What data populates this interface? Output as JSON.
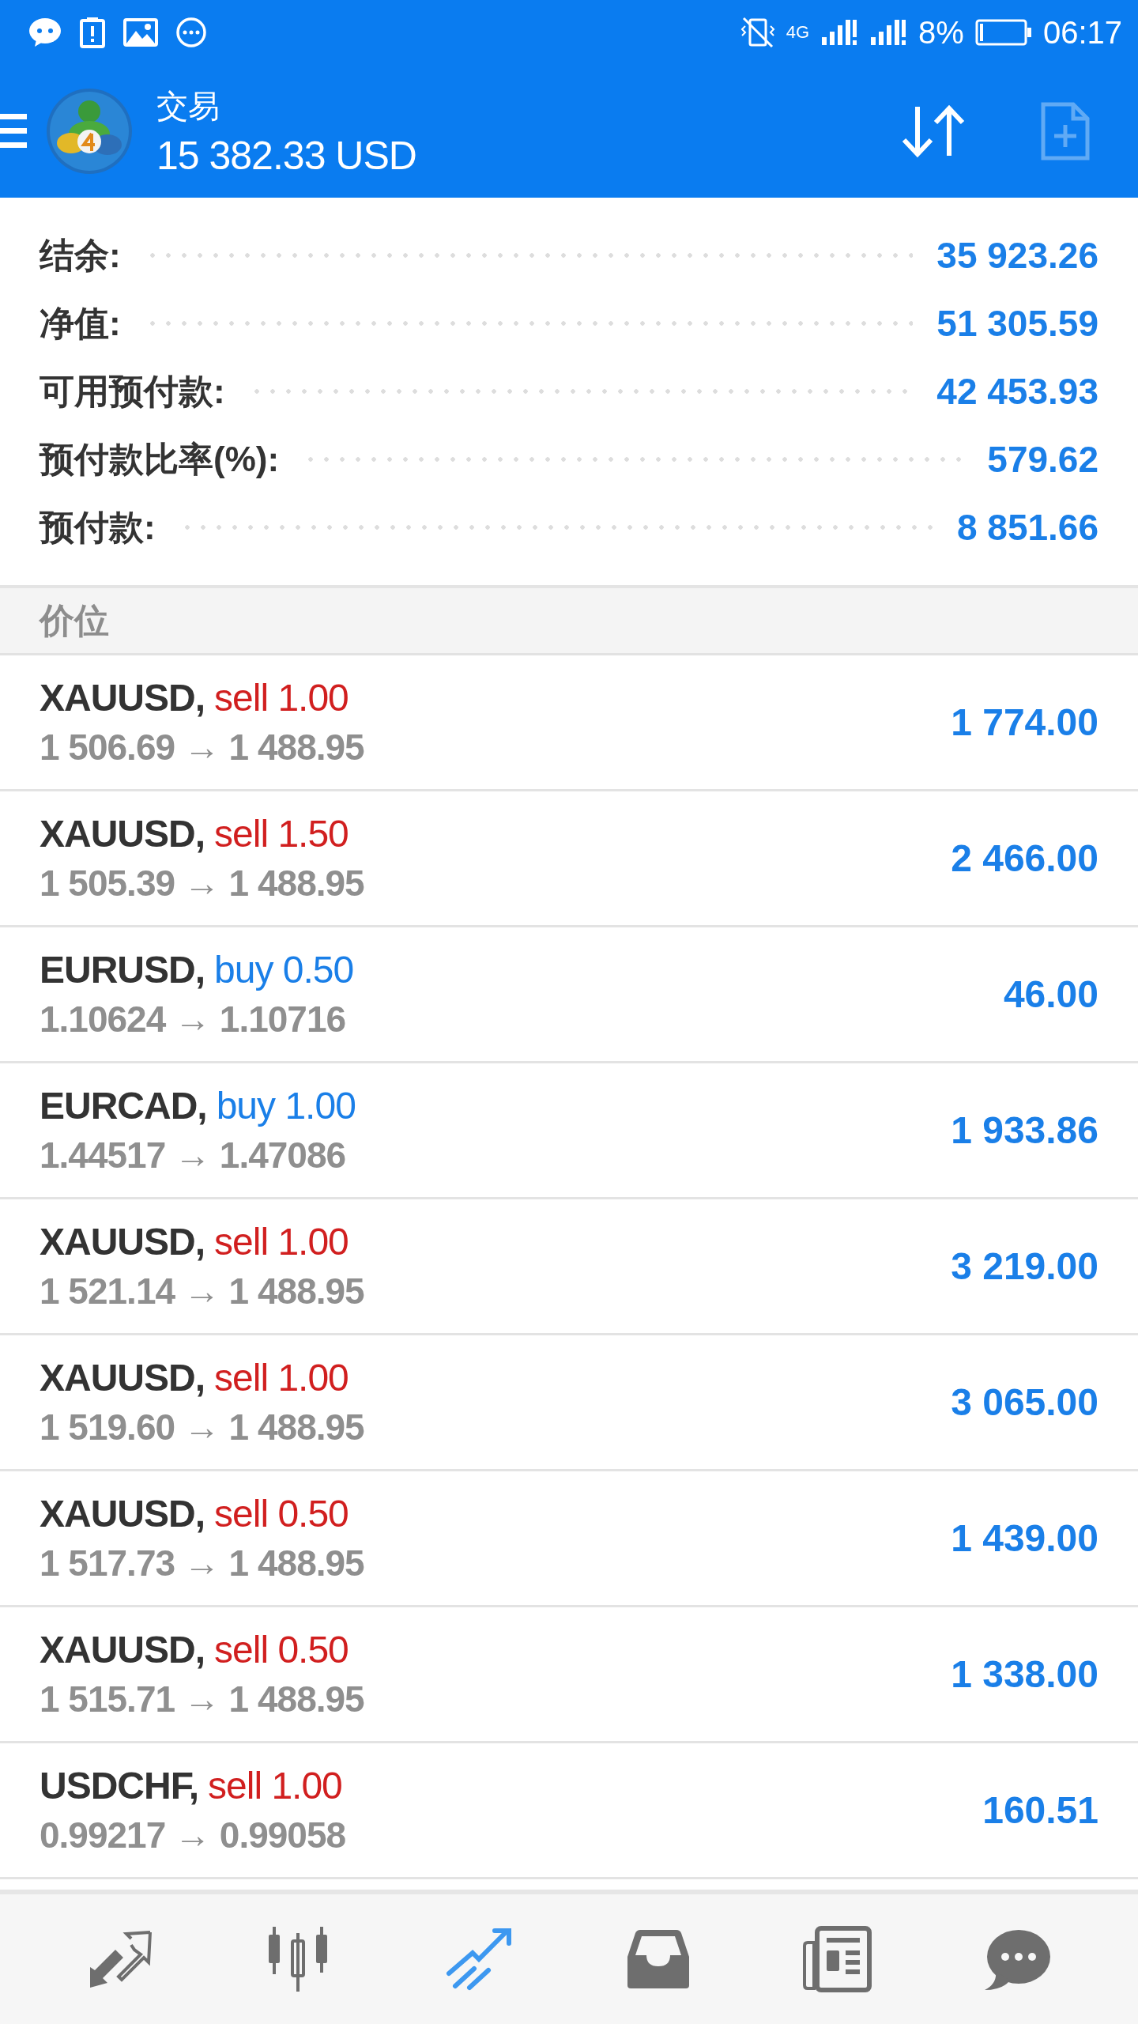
{
  "status_bar": {
    "network": "4G",
    "battery": "8%",
    "time": "06:17"
  },
  "header": {
    "title": "交易",
    "balance": "15 382.33 USD",
    "new_order_disabled": true
  },
  "summary": [
    {
      "label": "结余:",
      "value": "35 923.26"
    },
    {
      "label": "净值:",
      "value": "51 305.59"
    },
    {
      "label": "可用预付款:",
      "value": "42 453.93"
    },
    {
      "label": "预付款比率(%):",
      "value": "579.62"
    },
    {
      "label": "预付款:",
      "value": "8 851.66"
    }
  ],
  "section_title": "价位",
  "positions": [
    {
      "symbol": "XAUUSD,",
      "kind": "sell",
      "order": "sell 1.00",
      "prices": "1 506.69 → 1 488.95",
      "profit": "1 774.00"
    },
    {
      "symbol": "XAUUSD,",
      "kind": "sell",
      "order": "sell 1.50",
      "prices": "1 505.39 → 1 488.95",
      "profit": "2 466.00"
    },
    {
      "symbol": "EURUSD,",
      "kind": "buy",
      "order": "buy 0.50",
      "prices": "1.10624 → 1.10716",
      "profit": "46.00"
    },
    {
      "symbol": "EURCAD,",
      "kind": "buy",
      "order": "buy 1.00",
      "prices": "1.44517 → 1.47086",
      "profit": "1 933.86"
    },
    {
      "symbol": "XAUUSD,",
      "kind": "sell",
      "order": "sell 1.00",
      "prices": "1 521.14 → 1 488.95",
      "profit": "3 219.00"
    },
    {
      "symbol": "XAUUSD,",
      "kind": "sell",
      "order": "sell 1.00",
      "prices": "1 519.60 → 1 488.95",
      "profit": "3 065.00"
    },
    {
      "symbol": "XAUUSD,",
      "kind": "sell",
      "order": "sell 0.50",
      "prices": "1 517.73 → 1 488.95",
      "profit": "1 439.00"
    },
    {
      "symbol": "XAUUSD,",
      "kind": "sell",
      "order": "sell 0.50",
      "prices": "1 515.71 → 1 488.95",
      "profit": "1 338.00"
    },
    {
      "symbol": "USDCHF,",
      "kind": "sell",
      "order": "sell 1.00",
      "prices": "0.99217 → 0.99058",
      "profit": "160.51"
    }
  ],
  "bottom_nav": [
    {
      "kind": "quotes",
      "selected": false
    },
    {
      "kind": "chart",
      "selected": false
    },
    {
      "kind": "trade",
      "selected": true
    },
    {
      "kind": "history",
      "selected": false
    },
    {
      "kind": "news",
      "selected": false
    },
    {
      "kind": "chat",
      "selected": false
    }
  ]
}
